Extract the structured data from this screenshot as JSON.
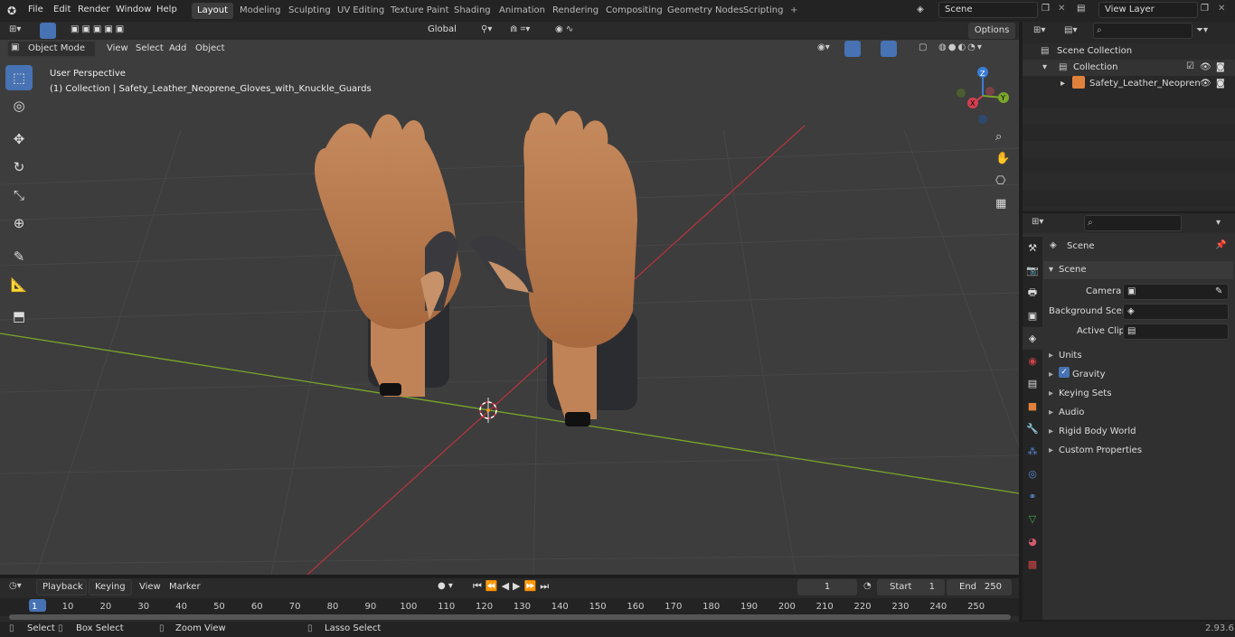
{
  "menu": [
    "File",
    "Edit",
    "Render",
    "Window",
    "Help"
  ],
  "workspaces": [
    "Layout",
    "Modeling",
    "Sculpting",
    "UV Editing",
    "Texture Paint",
    "Shading",
    "Animation",
    "Rendering",
    "Compositing",
    "Geometry Nodes",
    "Scripting"
  ],
  "scene_field": "Scene",
  "view_layer_field": "View Layer",
  "viewport_header": {
    "mode": "Object Mode",
    "view": "View",
    "select": "Select",
    "add": "Add",
    "object": "Object",
    "transform": "Global",
    "options": "Options"
  },
  "overlay": {
    "perspective": "User Perspective",
    "collection": "(1) Collection | Safety_Leather_Neoprene_Gloves_with_Knuckle_Guards"
  },
  "gizmo": {
    "x": "X",
    "y": "Y",
    "z": "Z"
  },
  "outliner": {
    "root": "Scene Collection",
    "collection": "Collection",
    "object": "Safety_Leather_Neopren"
  },
  "properties": {
    "title": "Scene",
    "section": "Scene",
    "camera": "Camera",
    "background_scene": "Background Scene",
    "active_clip": "Active Clip",
    "panels": [
      "Units",
      "Gravity",
      "Keying Sets",
      "Audio",
      "Rigid Body World",
      "Custom Properties"
    ]
  },
  "timeline": {
    "playback": "Playback",
    "keying": "Keying",
    "view": "View",
    "marker": "Marker",
    "current_frame": "1",
    "start_label": "Start",
    "start": "1",
    "end_label": "End",
    "end": "250",
    "ticks": [
      "1",
      "10",
      "20",
      "30",
      "40",
      "50",
      "60",
      "70",
      "80",
      "90",
      "100",
      "110",
      "120",
      "130",
      "140",
      "150",
      "160",
      "170",
      "180",
      "190",
      "200",
      "210",
      "220",
      "230",
      "240",
      "250"
    ]
  },
  "status": {
    "select": "Select",
    "box_select": "Box Select",
    "zoom_view": "Zoom View",
    "lasso_select": "Lasso Select",
    "version": "2.93.6"
  }
}
